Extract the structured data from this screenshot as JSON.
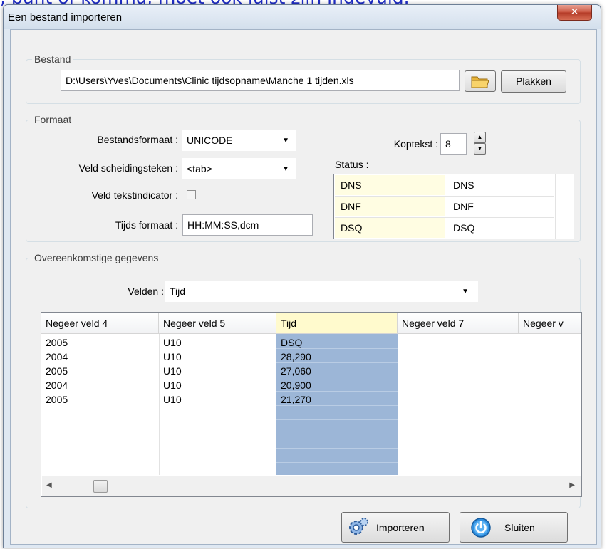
{
  "background_caption": ", punt of komma, moet ook juist zijn ingevuld.",
  "window": {
    "title": "Een bestand importeren",
    "close_glyph": "✕"
  },
  "bestand": {
    "legend": "Bestand",
    "path": "D:\\Users\\Yves\\Documents\\Clinic tijdsopname\\Manche 1 tijden.xls",
    "paste_label": "Plakken",
    "browse_icon": "folder-icon"
  },
  "formaat": {
    "legend": "Formaat",
    "file_format_label": "Bestandsformaat :",
    "file_format_value": "UNICODE",
    "separator_label": "Veld scheidingsteken :",
    "separator_value": "<tab>",
    "text_indicator_label": "Veld tekstindicator :",
    "text_indicator_checked": false,
    "time_format_label": "Tijds formaat :",
    "time_format_value": "HH:MM:SS,dcm",
    "header_label": "Koptekst :",
    "header_value": "8",
    "status_label": "Status :",
    "status_rows": [
      {
        "code": "DNS",
        "value": "DNS"
      },
      {
        "code": "DNF",
        "value": "DNF"
      },
      {
        "code": "DSQ",
        "value": "DSQ"
      }
    ]
  },
  "gegevens": {
    "legend": "Overeenkomstige gegevens",
    "fields_label": "Velden :",
    "fields_value": "Tijd",
    "columns": [
      "Negeer veld 4",
      "Negeer veld 5",
      "Tijd",
      "Negeer veld 7",
      "Negeer v"
    ],
    "selected_column": "Tijd",
    "rows": [
      [
        "2005",
        "U10",
        "DSQ",
        "",
        ""
      ],
      [
        "2004",
        "U10",
        "28,290",
        "",
        ""
      ],
      [
        "2005",
        "U10",
        "27,060",
        "",
        ""
      ],
      [
        "2004",
        "U10",
        "20,900",
        "",
        ""
      ],
      [
        "2005",
        "U10",
        "21,270",
        "",
        ""
      ]
    ]
  },
  "footer": {
    "import_label": "Importeren",
    "import_icon": "gears-icon",
    "close_label": "Sluiten",
    "close_icon": "power-icon"
  },
  "colors": {
    "selected_column": "#9cb6d7",
    "status_code_bg": "#fffde2",
    "selected_header": "#fffacd"
  }
}
